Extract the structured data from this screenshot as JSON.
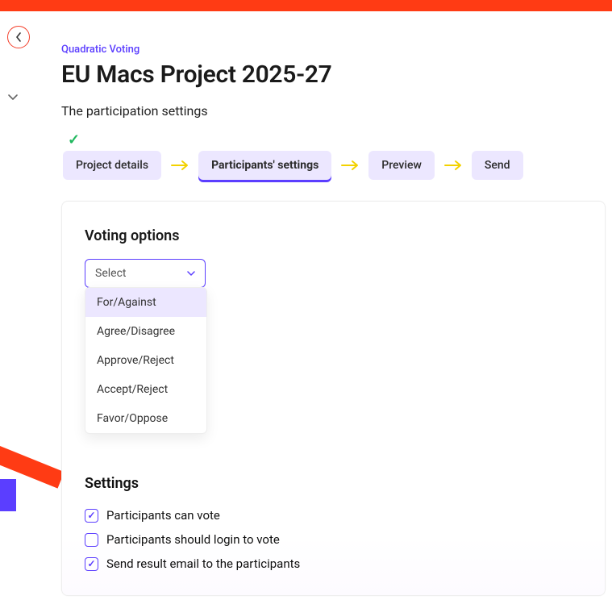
{
  "eyebrow": "Quadratic Voting",
  "page_title": "EU Macs Project 2025-27",
  "subtitle": "The participation settings",
  "stepper": {
    "steps": [
      {
        "label": "Project details",
        "completed": true
      },
      {
        "label": "Participants' settings",
        "active": true
      },
      {
        "label": "Preview"
      },
      {
        "label": "Send"
      }
    ]
  },
  "voting_options": {
    "title": "Voting options",
    "placeholder": "Select",
    "options": [
      "For/Against",
      "Agree/Disagree",
      "Approve/Reject",
      "Accept/Reject",
      "Favor/Oppose"
    ]
  },
  "settings": {
    "title": "Settings",
    "items": [
      {
        "label": "Participants can vote",
        "checked": true
      },
      {
        "label": "Participants should login to vote",
        "checked": false
      },
      {
        "label": "Send result email to the participants",
        "checked": true
      }
    ]
  }
}
